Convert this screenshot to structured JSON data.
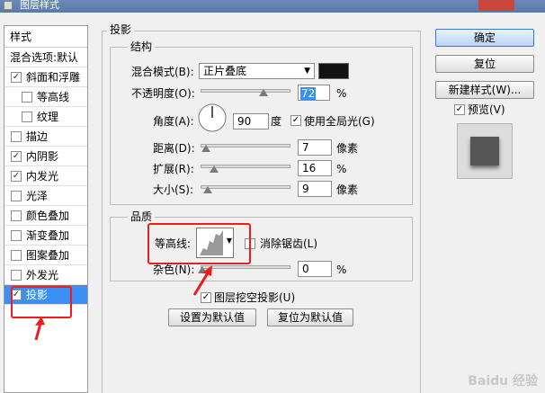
{
  "window": {
    "title": "图层样式"
  },
  "style_list": {
    "header": "样式",
    "items": [
      {
        "label": "混合选项:默认",
        "checked": null
      },
      {
        "label": "斜面和浮雕",
        "checked": true
      },
      {
        "label": "等高线",
        "checked": false
      },
      {
        "label": "纹理",
        "checked": false
      },
      {
        "label": "描边",
        "checked": false
      },
      {
        "label": "内阴影",
        "checked": true
      },
      {
        "label": "内发光",
        "checked": true
      },
      {
        "label": "光泽",
        "checked": false
      },
      {
        "label": "颜色叠加",
        "checked": false
      },
      {
        "label": "渐变叠加",
        "checked": false
      },
      {
        "label": "图案叠加",
        "checked": false
      },
      {
        "label": "外发光",
        "checked": false
      },
      {
        "label": "投影",
        "checked": true
      }
    ]
  },
  "panel": {
    "section_title": "投影",
    "structure": {
      "title": "结构",
      "blend_mode_label": "混合模式(B):",
      "blend_mode_value": "正片叠底",
      "blend_color": "#111111",
      "opacity_label": "不透明度(O):",
      "opacity_value": "72",
      "opacity_unit": "%",
      "opacity_fraction": 0.72,
      "angle_label": "角度(A):",
      "angle_value": "90",
      "angle_unit": "度",
      "global_light_label": "使用全局光(G)",
      "global_light_checked": true,
      "distance_label": "距离(D):",
      "distance_value": "7",
      "distance_unit": "像素",
      "spread_label": "扩展(R):",
      "spread_value": "16",
      "spread_unit": "%",
      "size_label": "大小(S):",
      "size_value": "9",
      "size_unit": "像素"
    },
    "quality": {
      "title": "品质",
      "contour_label": "等高线:",
      "antialias_label": "消除锯齿(L)",
      "antialias_checked": false,
      "noise_label": "杂色(N):",
      "noise_value": "0",
      "noise_unit": "%"
    },
    "knockout_label": "图层挖空投影(U)",
    "knockout_checked": true,
    "make_default": "设置为默认值",
    "reset_default": "复位为默认值"
  },
  "buttons": {
    "ok": "确定",
    "reset": "复位",
    "new_style": "新建样式(W)...",
    "preview_label": "预览(V)",
    "preview_checked": true
  },
  "colors": {
    "selection": "#3c8ff3",
    "highlight": "#ee1c1c"
  },
  "watermark": "Baidu 经验"
}
